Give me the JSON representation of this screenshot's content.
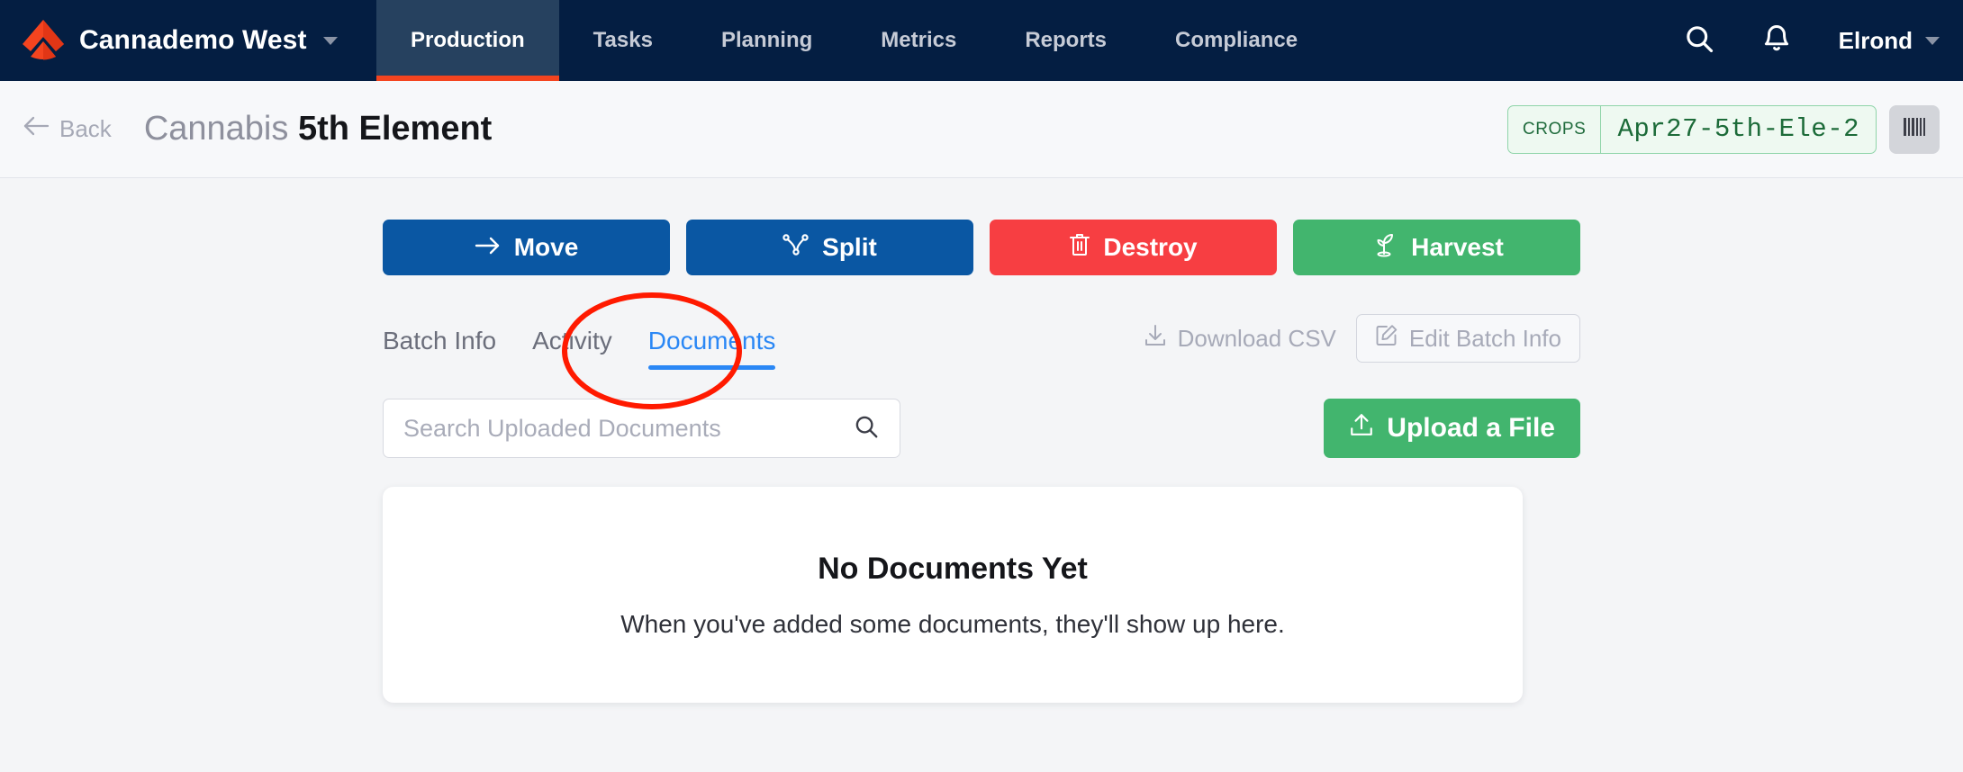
{
  "topnav": {
    "brand": {
      "name": "Cannademo West",
      "logo_icon": "cannabis-chevron-logo",
      "caret_icon": "chevron-down-icon"
    },
    "tabs": [
      {
        "label": "Production",
        "active": true
      },
      {
        "label": "Tasks",
        "active": false
      },
      {
        "label": "Planning",
        "active": false
      },
      {
        "label": "Metrics",
        "active": false
      },
      {
        "label": "Reports",
        "active": false
      },
      {
        "label": "Compliance",
        "active": false
      }
    ],
    "search_icon": "search-icon",
    "notifications_icon": "bell-icon",
    "user": {
      "name": "Elrond",
      "caret_icon": "chevron-down-icon"
    },
    "colors": {
      "background": "#041e42",
      "active_tab_bg": "#26415f",
      "active_underline": "#f4441f"
    }
  },
  "pagehead": {
    "back_label": "Back",
    "back_icon": "arrow-left-icon",
    "title_prefix": "Cannabis",
    "title_main": "5th Element",
    "tag": {
      "label": "CROPS",
      "value": "Apr27-5th-Ele-2"
    },
    "barcode_icon": "barcode-icon"
  },
  "actions": [
    {
      "label": "Move",
      "icon": "arrow-right-icon",
      "color": "#0a57a3"
    },
    {
      "label": "Split",
      "icon": "split-branch-icon",
      "color": "#0a57a3"
    },
    {
      "label": "Destroy",
      "icon": "trash-icon",
      "color": "#f73e42"
    },
    {
      "label": "Harvest",
      "icon": "sprout-icon",
      "color": "#42b56e"
    }
  ],
  "tabs": [
    {
      "label": "Batch Info",
      "active": false
    },
    {
      "label": "Activity",
      "active": false
    },
    {
      "label": "Documents",
      "active": true
    }
  ],
  "tab_actions": {
    "download_csv": {
      "label": "Download CSV",
      "icon": "download-icon"
    },
    "edit_batch_info": {
      "label": "Edit Batch Info",
      "icon": "edit-pencil-icon"
    }
  },
  "toolbar": {
    "search_placeholder": "Search Uploaded Documents",
    "search_value": "",
    "search_icon": "search-icon",
    "upload": {
      "label": "Upload a File",
      "icon": "upload-icon"
    }
  },
  "empty_state": {
    "title": "No Documents Yet",
    "subtitle": "When you've added some documents, they'll show up here."
  },
  "annotation": {
    "shape": "ellipse",
    "color": "#ff1a00",
    "targets": "documents-tab"
  }
}
